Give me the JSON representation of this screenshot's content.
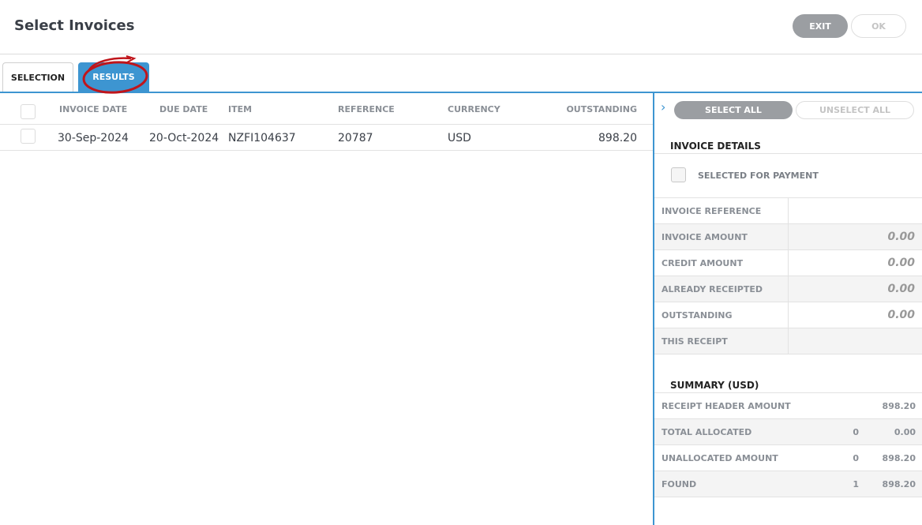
{
  "header": {
    "title": "Select Invoices",
    "exit_label": "EXIT",
    "ok_label": "OK"
  },
  "tabs": [
    {
      "label": "SELECTION",
      "active": false
    },
    {
      "label": "RESULTS",
      "active": true
    }
  ],
  "table": {
    "columns": [
      "INVOICE DATE",
      "DUE DATE",
      "ITEM",
      "REFERENCE",
      "CURRENCY",
      "OUTSTANDING"
    ],
    "rows": [
      {
        "invoice_date": "30-Sep-2024",
        "due_date": "20-Oct-2024",
        "item": "NZFI104637",
        "reference": "20787",
        "currency": "USD",
        "outstanding": "898.20"
      }
    ]
  },
  "side": {
    "select_all_label": "SELECT ALL",
    "unselect_all_label": "UNSELECT ALL",
    "details_title": "INVOICE DETAILS",
    "selected_for_payment_label": "SELECTED FOR PAYMENT",
    "details": [
      {
        "label": "INVOICE REFERENCE",
        "value": ""
      },
      {
        "label": "INVOICE AMOUNT",
        "value": "0.00"
      },
      {
        "label": "CREDIT AMOUNT",
        "value": "0.00"
      },
      {
        "label": "ALREADY RECEIPTED",
        "value": "0.00"
      },
      {
        "label": "OUTSTANDING",
        "value": "0.00"
      },
      {
        "label": "THIS RECEIPT",
        "value": ""
      }
    ],
    "summary_title": "SUMMARY (USD)",
    "summary": [
      {
        "label": "RECEIPT HEADER AMOUNT",
        "count": "",
        "amount": "898.20"
      },
      {
        "label": "TOTAL ALLOCATED",
        "count": "0",
        "amount": "0.00"
      },
      {
        "label": "UNALLOCATED AMOUNT",
        "count": "0",
        "amount": "898.20"
      },
      {
        "label": "FOUND",
        "count": "1",
        "amount": "898.20"
      }
    ]
  },
  "colors": {
    "accent": "#3d95d1",
    "button_grey": "#9b9ea2",
    "annotation": "#c0151b"
  },
  "icons": {
    "expand": "chevron-right-icon"
  }
}
